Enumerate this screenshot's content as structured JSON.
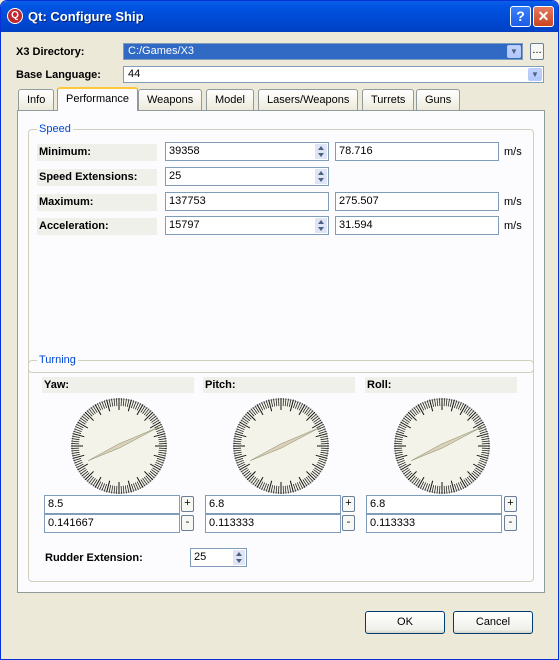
{
  "window": {
    "title": "Qt: Configure Ship",
    "app_icon": "qt-icon",
    "help": "?",
    "close": "✕"
  },
  "x3_directory": {
    "label": "X3 Directory:",
    "value": "C:/Games/X3",
    "browse": "..."
  },
  "base_language": {
    "label": "Base Language:",
    "value": "44"
  },
  "tabs": [
    {
      "label": "Info"
    },
    {
      "label": "Performance",
      "active": true
    },
    {
      "label": "Weapons"
    },
    {
      "label": "Model"
    },
    {
      "label": "Lasers/Weapons"
    },
    {
      "label": "Turrets"
    },
    {
      "label": "Guns"
    }
  ],
  "speed": {
    "title": "Speed",
    "minimum": {
      "label": "Minimum:",
      "value": "39358",
      "converted": "78.716",
      "unit": "m/s"
    },
    "extensions": {
      "label": "Speed Extensions:",
      "value": "25"
    },
    "maximum": {
      "label": "Maximum:",
      "value": "137753",
      "converted": "275.507",
      "unit": "m/s"
    },
    "acceleration": {
      "label": "Acceleration:",
      "value": "15797",
      "converted": "31.594",
      "unit": "m/s"
    }
  },
  "turning": {
    "title": "Turning",
    "yaw": {
      "label": "Yaw:",
      "value": "8.5",
      "converted": "0.141667",
      "plus": "+",
      "minus": "-"
    },
    "pitch": {
      "label": "Pitch:",
      "value": "6.8",
      "converted": "0.113333",
      "plus": "+",
      "minus": "-"
    },
    "roll": {
      "label": "Roll:",
      "value": "6.8",
      "converted": "0.113333",
      "plus": "+",
      "minus": "-"
    },
    "rudder": {
      "label": "Rudder Extension:",
      "value": "25"
    }
  },
  "buttons": {
    "ok": "OK",
    "cancel": "Cancel"
  }
}
